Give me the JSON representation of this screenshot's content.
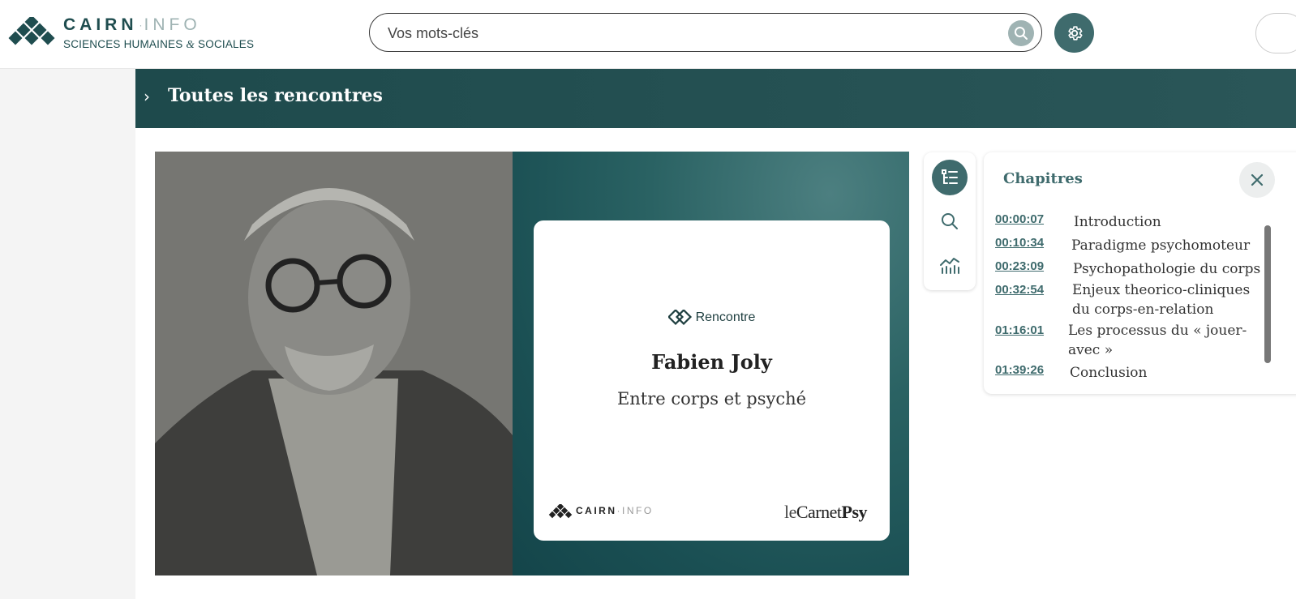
{
  "header": {
    "logo_word_main": "CAIRN",
    "logo_word_dot": "·",
    "logo_word_info": "INFO",
    "logo_sub_a": "SCIENCES HUMAINES",
    "logo_sub_amp": "&",
    "logo_sub_b": "SOCIALES",
    "search_placeholder": "Vos mots-clés",
    "icons": [
      "search-icon",
      "gear-icon"
    ]
  },
  "banner": {
    "chevron": "›",
    "title": "Toutes les rencontres"
  },
  "video": {
    "card": {
      "tag": "Rencontre",
      "name": "Fabien Joly",
      "subtitle": "Entre corps et psyché",
      "footer_left_main": "CAIRN",
      "footer_left_dot": "·",
      "footer_left_info": "INFO",
      "footer_right_a": "le",
      "footer_right_b": "Carnet",
      "footer_right_c": "Psy"
    }
  },
  "toolbar": {
    "items": [
      "chapters-icon",
      "search-icon",
      "stats-icon"
    ]
  },
  "chapters": {
    "title": "Chapitres",
    "items": [
      {
        "time": "00:00:07",
        "label": "Introduction"
      },
      {
        "time": "00:10:34",
        "label": "Paradigme psychomoteur"
      },
      {
        "time": "00:23:09",
        "label": "Psychopathologie du corps"
      },
      {
        "time": "00:32:54",
        "label": "Enjeux theorico-cliniques du corps-en-relation"
      },
      {
        "time": "01:16:01",
        "label": "Les processus du « jouer-avec »"
      },
      {
        "time": "01:39:26",
        "label": "Conclusion"
      }
    ]
  },
  "colors": {
    "brand_teal": "#1f4d4f",
    "accent": "#3f6b6d",
    "muted": "#9fb3b3"
  }
}
